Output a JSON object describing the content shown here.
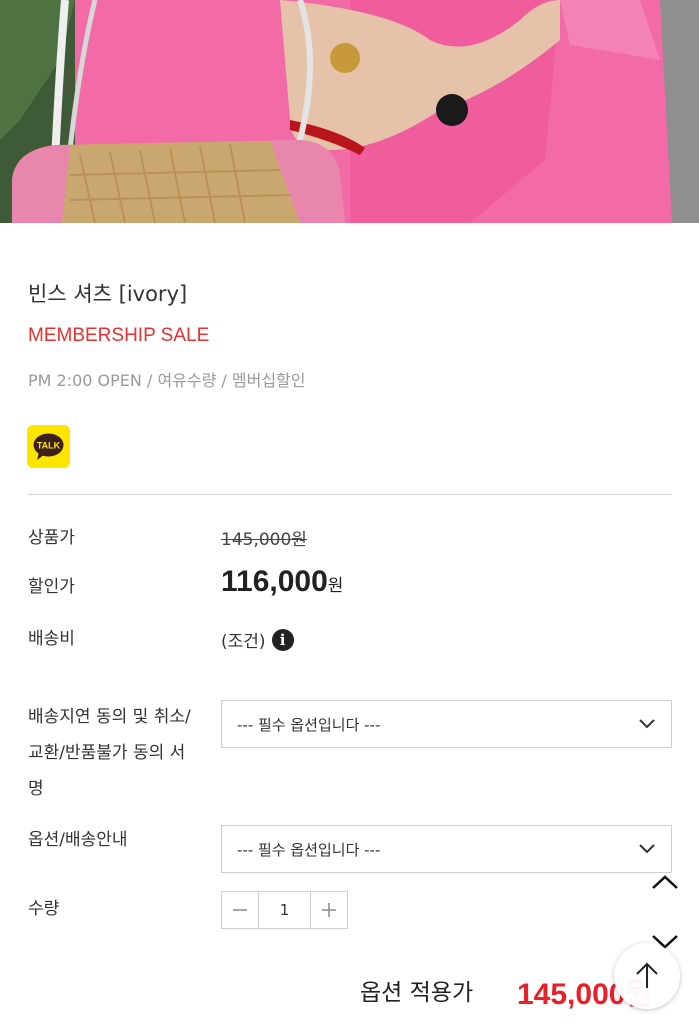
{
  "product": {
    "title": "빈스 셔츠 [ivory]",
    "sale_badge": "MEMBERSHIP SALE",
    "notice": "PM 2:00 OPEN / 여유수량 / 멤버십할인",
    "talk_label": "TALK"
  },
  "prices": {
    "original_label": "상품가",
    "original_value": "145,000원",
    "sale_label": "할인가",
    "sale_value": "116,000",
    "sale_unit": "원",
    "shipping_label": "배송비",
    "shipping_value": "(조건)"
  },
  "options": {
    "delay_label_line1": "배송지연 동의 및 취소/",
    "delay_label_line2": "교환/반품불가 동의 서",
    "delay_label_line3": "명",
    "delay_placeholder": "--- 필수 옵션입니다 ---",
    "shipping_info_label": "옵션/배송안내",
    "shipping_info_placeholder": "--- 필수 옵션입니다 ---"
  },
  "quantity": {
    "label": "수량",
    "value": "1"
  },
  "total": {
    "label": "옵션 적용가",
    "value": "145,000원"
  },
  "colors": {
    "sale_red": "#e8312f",
    "talk_yellow": "#fee500",
    "jacket_pink": "#f15b9c"
  }
}
